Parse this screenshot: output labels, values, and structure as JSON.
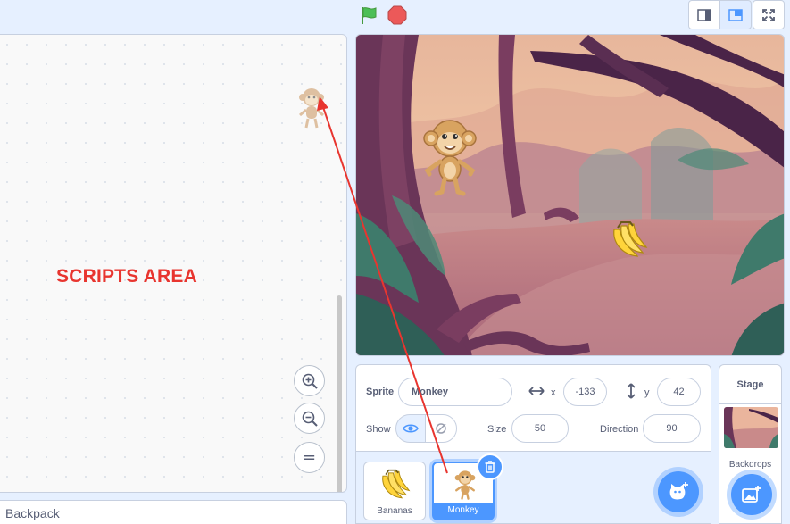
{
  "toolbar": {
    "green_flag_icon": "green-flag-icon",
    "stop_icon": "stop-icon",
    "layout_buttons": [
      "small-stage-icon",
      "normal-stage-icon",
      "fullscreen-icon"
    ]
  },
  "scripts_area": {
    "label": "SCRIPTS AREA",
    "zoom_icons": [
      "zoom-in-icon",
      "zoom-out-icon",
      "zoom-reset-icon"
    ],
    "zoom_reset_glyph": "="
  },
  "backpack": {
    "label": "Backpack"
  },
  "sprite_info": {
    "sprite_label": "Sprite",
    "sprite_name": "Monkey",
    "x_label": "x",
    "x_value": "-133",
    "y_label": "y",
    "y_value": "42",
    "show_label": "Show",
    "size_label": "Size",
    "size_value": "50",
    "direction_label": "Direction",
    "direction_value": "90"
  },
  "sprites": [
    {
      "name": "Bananas",
      "selected": false
    },
    {
      "name": "Monkey",
      "selected": true
    }
  ],
  "stage_pane": {
    "title": "Stage",
    "backdrops_label": "Backdrops"
  },
  "colors": {
    "accent": "#4c97ff",
    "annotation": "#e8352f",
    "flag": "#4cbf56",
    "stop": "#ec5959"
  }
}
